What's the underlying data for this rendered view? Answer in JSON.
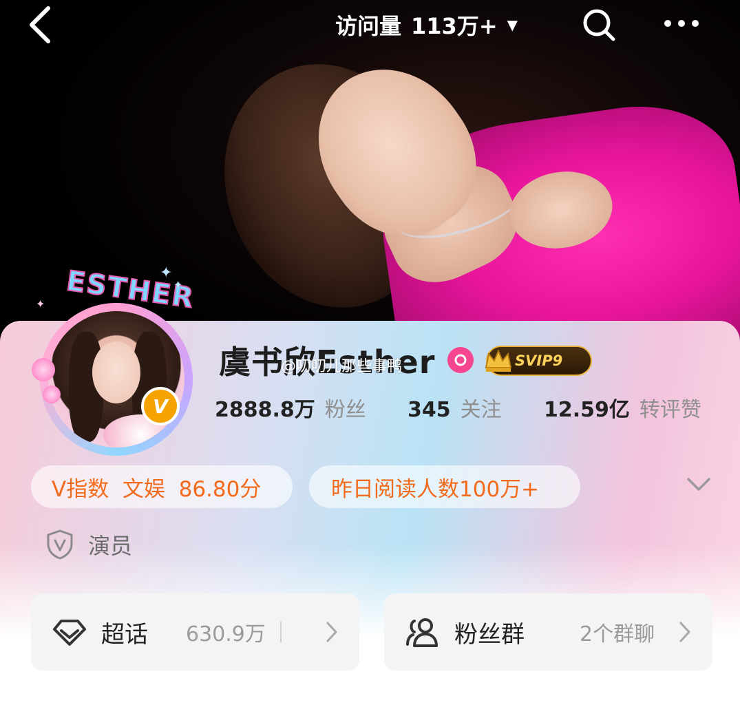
{
  "header": {
    "visits_label": "访问量",
    "visits_value": "113万+"
  },
  "profile": {
    "name": "虞书欣Esther",
    "avatar_frame_text": "ESTHER",
    "vip_level": "SVIP9",
    "watermark": "@叨叨儿那些事鸭"
  },
  "stats": [
    {
      "value": "2888.8万",
      "label": "粉丝"
    },
    {
      "value": "345",
      "label": "关注"
    },
    {
      "value": "12.59亿",
      "label": "转评赞"
    }
  ],
  "badges": {
    "v_index": "V指数  文娱  86.80分",
    "yesterday_reads": "昨日阅读人数100万+"
  },
  "role": {
    "label": "演员"
  },
  "quick_cards": {
    "topic": {
      "title": "超话",
      "value": "630.9万"
    },
    "group": {
      "title": "粉丝群",
      "value": "2个群聊"
    }
  },
  "colors": {
    "accent_orange": "#f26b1d",
    "gender_pink": "#f6468f",
    "vip_gold": "#e9b43b"
  },
  "icons": [
    "back-arrow-icon",
    "search-icon",
    "more-icon",
    "female-icon",
    "crown-icon",
    "verified-icon",
    "chevron-down-icon",
    "shield-icon",
    "diamond-icon",
    "group-icon",
    "chevron-right-icon"
  ]
}
